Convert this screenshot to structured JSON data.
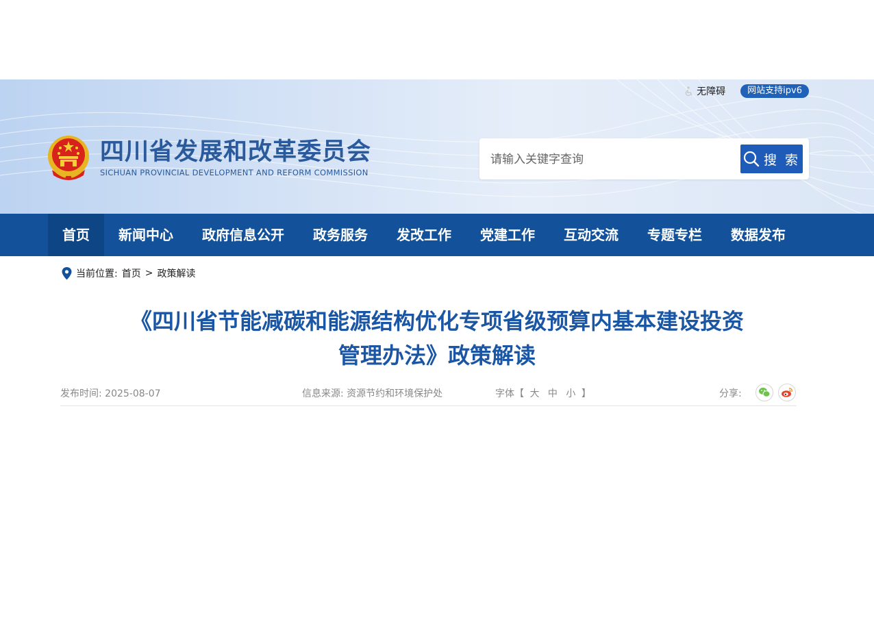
{
  "header": {
    "accessibility_label": "无障碍",
    "ipv6_badge": "网站支持ipv6",
    "site_name_cn": "四川省发展和改革委员会",
    "site_name_en": "SICHUAN PROVINCIAL DEVELOPMENT AND REFORM COMMISSION",
    "search_placeholder": "请输入关键字查询",
    "search_button": "搜 索"
  },
  "nav": {
    "items": [
      {
        "label": "首页",
        "active": true
      },
      {
        "label": "新闻中心"
      },
      {
        "label": "政府信息公开"
      },
      {
        "label": "政务服务"
      },
      {
        "label": "发改工作"
      },
      {
        "label": "党建工作"
      },
      {
        "label": "互动交流"
      },
      {
        "label": "专题专栏"
      },
      {
        "label": "数据发布"
      }
    ]
  },
  "breadcrumb": {
    "prefix": "当前位置:",
    "home": "首页",
    "separator": ">",
    "current": "政策解读"
  },
  "article": {
    "title_line1": "《四川省节能减碳和能源结构优化专项省级预算内基本建设投资",
    "title_line2": "管理办法》政策解读",
    "date_label": "发布时间:",
    "date": "2025-08-07",
    "source_label": "信息来源:",
    "source": "资源节约和环境保护处",
    "font_label": "字体【",
    "font_large": "大",
    "font_medium": "中",
    "font_small": "小",
    "font_close": "】",
    "share_label": "分享:"
  },
  "colors": {
    "nav_bg": "#13529a",
    "nav_active": "#0e4585",
    "title": "#1a56a4",
    "search_button": "#1f5bb8"
  },
  "icons": [
    "accessibility-icon",
    "national-emblem-icon",
    "search-icon",
    "location-pin-icon",
    "wechat-icon",
    "weibo-icon"
  ]
}
